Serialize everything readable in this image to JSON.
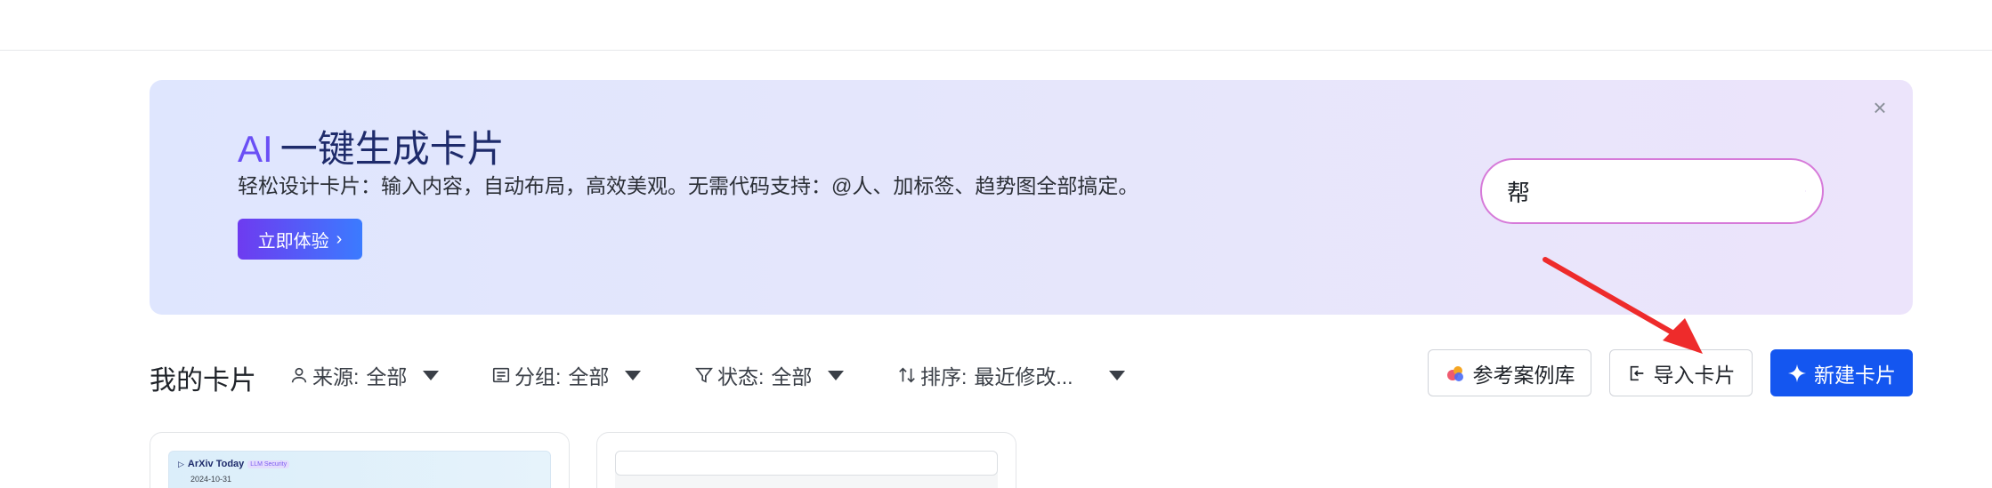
{
  "banner": {
    "title_ai": "AI",
    "title_rest": "一键生成卡片",
    "subtitle": "轻松设计卡片：输入内容，自动布局，高效美观。无需代码支持：@人、加标签、趋势图全部搞定。",
    "try_button": "立即体验",
    "close_icon": "close-icon",
    "input_value": "帮",
    "send_icon": "send-icon"
  },
  "toolbar": {
    "title": "我的卡片",
    "filters": [
      {
        "icon": "user-icon",
        "label": "来源:",
        "value": "全部"
      },
      {
        "icon": "group-icon",
        "label": "分组:",
        "value": "全部"
      },
      {
        "icon": "filter-icon",
        "label": "状态:",
        "value": "全部"
      },
      {
        "icon": "sort-icon",
        "label": "排序:",
        "value": "最近修改..."
      }
    ],
    "buttons": {
      "examples": "参考案例库",
      "import": "导入卡片",
      "new": "新建卡片"
    }
  },
  "cards": [
    {
      "title": "ArXiv Today",
      "tag": "LLM Security",
      "date": "2024-10-31"
    },
    {
      "title": "",
      "tag": "",
      "date": ""
    }
  ],
  "colors": {
    "primary": "#1456f0",
    "accent_purple": "#6a4ff5",
    "input_border": "#d67ad9"
  }
}
